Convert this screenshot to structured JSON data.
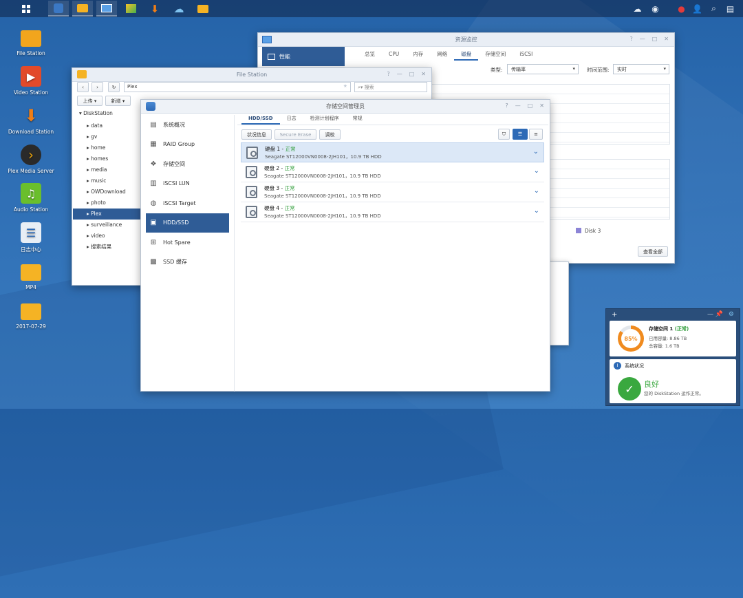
{
  "taskbar": {
    "apps": [
      "main-menu",
      "file-station",
      "download-station",
      "resource-monitor",
      "photo",
      "download",
      "cloud",
      "file-folder"
    ]
  },
  "desktop": {
    "icons": [
      {
        "label": "File Station",
        "icon": "folder-search-icon",
        "color": "#f2a51d"
      },
      {
        "label": "Video Station",
        "icon": "video-icon",
        "color": "#e24a2a"
      },
      {
        "label": "Download Station",
        "icon": "download-arrow-icon",
        "color": "#f07e16"
      },
      {
        "label": "Plex Media Server",
        "icon": "plex-icon",
        "color": "#2a2a2a"
      },
      {
        "label": "Audio Station",
        "icon": "music-icon",
        "color": "#6abf2c"
      },
      {
        "label": "日志中心",
        "icon": "log-icon",
        "color": "#e8eef5"
      },
      {
        "label": "MP4",
        "icon": "folder-icon",
        "color": "#f5b324"
      },
      {
        "label": "2017-07-29",
        "icon": "folder-icon",
        "color": "#f5b324"
      }
    ]
  },
  "resource_monitor": {
    "title": "资源监控",
    "side_selected": "性能",
    "tabs": [
      "总览",
      "CPU",
      "内存",
      "网络",
      "磁盘",
      "存储空间",
      "iSCSI"
    ],
    "active_tab": "磁盘",
    "type_label": "类型:",
    "type_value": "传输率",
    "time_label": "时间范围:",
    "time_value": "实时",
    "legend": "Disk 3",
    "view_all": "查看全部"
  },
  "file_station": {
    "title": "File Station",
    "path": "Plex",
    "search_placeholder": "搜索",
    "upload": "上传",
    "new": "新增",
    "root": "DiskStation",
    "folders": [
      "data",
      "gv",
      "home",
      "homes",
      "media",
      "music",
      "OWDownload",
      "photo",
      "Plex",
      "surveillance",
      "video",
      "搜索结果"
    ],
    "selected": "Plex"
  },
  "storage_manager": {
    "title": "存储空间管理员",
    "side": [
      {
        "label": "系统概况",
        "icon": "overview-icon"
      },
      {
        "label": "RAID Group",
        "icon": "raid-icon"
      },
      {
        "label": "存储空间",
        "icon": "volume-icon"
      },
      {
        "label": "iSCSI LUN",
        "icon": "lun-icon"
      },
      {
        "label": "iSCSI Target",
        "icon": "target-icon"
      },
      {
        "label": "HDD/SSD",
        "icon": "hdd-icon"
      },
      {
        "label": "Hot Spare",
        "icon": "hotspare-icon"
      },
      {
        "label": "SSD 缓存",
        "icon": "ssd-cache-icon"
      }
    ],
    "selected_side": "HDD/SSD",
    "tabs": [
      "HDD/SSD",
      "日志",
      "检测计划程序",
      "常规"
    ],
    "active_tab": "HDD/SSD",
    "actions": {
      "status": "状况信息",
      "secure_erase": "Secure Erase",
      "adjust": "调校"
    },
    "disks": [
      {
        "name": "硬盘 1",
        "status": "正常",
        "model": "Seagate ST12000VN0008-2JH101，10.9 TB HDD"
      },
      {
        "name": "硬盘 2",
        "status": "正常",
        "model": "Seagate ST12000VN0008-2JH101，10.9 TB HDD"
      },
      {
        "name": "硬盘 3",
        "status": "正常",
        "model": "Seagate ST12000VN0008-2JH101，10.9 TB HDD"
      },
      {
        "name": "硬盘 4",
        "status": "正常",
        "model": "Seagate ST12000VN0008-2JH101，10.9 TB HDD"
      }
    ]
  },
  "widget": {
    "volume_title": "存储空间 1",
    "volume_status": "(正常)",
    "percent": "85%",
    "used": "已用容量: 8.86 TB",
    "total": "总容量: 1.6 TB",
    "health_title": "系统状况",
    "health_status": "良好",
    "health_desc": "您的 DiskStation 运作正常。"
  }
}
